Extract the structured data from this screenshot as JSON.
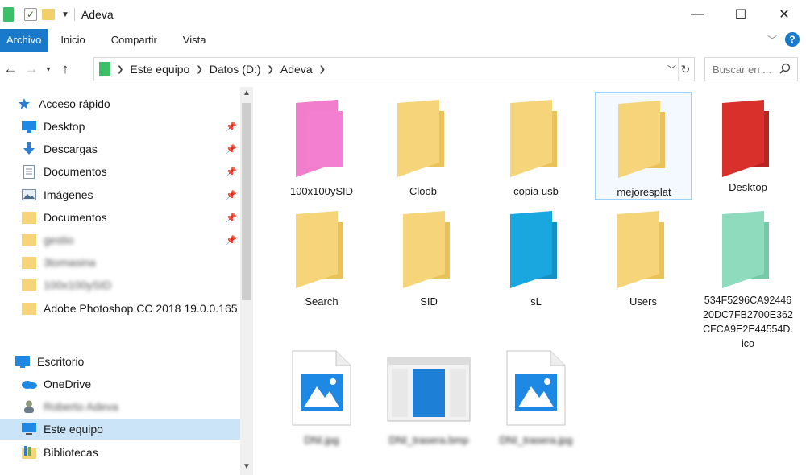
{
  "titlebar": {
    "title": "Adeva",
    "minimize_icon": "minimize-icon",
    "maximize_icon": "maximize-icon",
    "close_icon": "close-icon"
  },
  "ribbon": {
    "tabs": [
      "Archivo",
      "Inicio",
      "Compartir",
      "Vista"
    ],
    "active_tab": "Archivo",
    "accent": "#1979ca"
  },
  "address": {
    "crumbs": [
      "Este equipo",
      "Datos (D:)",
      "Adeva"
    ]
  },
  "search": {
    "placeholder": "Buscar en ..."
  },
  "sidebar": {
    "quick_access": "Acceso rápido",
    "items": [
      {
        "label": "Desktop",
        "icon": "desktop-icon",
        "pinned": true
      },
      {
        "label": "Descargas",
        "icon": "download-icon",
        "pinned": true
      },
      {
        "label": "Documentos",
        "icon": "documents-icon",
        "pinned": true
      },
      {
        "label": "Imágenes",
        "icon": "pictures-icon",
        "pinned": true
      },
      {
        "label": "Documentos",
        "icon": "folder-icon",
        "pinned": true
      },
      {
        "label": "gestio",
        "icon": "folder-icon",
        "pinned": true
      },
      {
        "label": "3tomasina",
        "icon": "folder-icon",
        "pinned": false
      },
      {
        "label": "100x100ySID",
        "icon": "folder-icon",
        "pinned": false
      },
      {
        "label": "Adobe Photoshop CC 2018 19.0.0.165 +",
        "icon": "folder-icon",
        "pinned": false
      }
    ],
    "escritorio": "Escritorio",
    "tree": [
      {
        "label": "OneDrive",
        "icon": "onedrive-icon"
      },
      {
        "label": "Roberto Adeva",
        "icon": "user-icon"
      },
      {
        "label": "Este equipo",
        "icon": "computer-icon"
      },
      {
        "label": "Bibliotecas",
        "icon": "libraries-icon"
      }
    ]
  },
  "files": [
    {
      "name": "100x100ySID",
      "color": "#f27fcf"
    },
    {
      "name": "Cloob",
      "color": "#f6d57a"
    },
    {
      "name": "copia usb",
      "color": "#f6d57a"
    },
    {
      "name": "mejoresplat",
      "color": "#f6d57a"
    },
    {
      "name": "Desktop",
      "color": "#d9302c"
    },
    {
      "name": "Search",
      "color": "#f6d57a"
    },
    {
      "name": "SID",
      "color": "#f6d57a"
    },
    {
      "name": "sL",
      "color": "#1aa7e0"
    },
    {
      "name": "Users",
      "color": "#f6d57a"
    },
    {
      "name": "534F5296CA9244620DC7FB2700E362CFCA9E2E44554D.ico",
      "color": "#8edcbd"
    },
    {
      "name": "DNI.jpg"
    },
    {
      "name": "DNI_trasera.bmp"
    },
    {
      "name": "DNI_trasera.jpg"
    }
  ]
}
